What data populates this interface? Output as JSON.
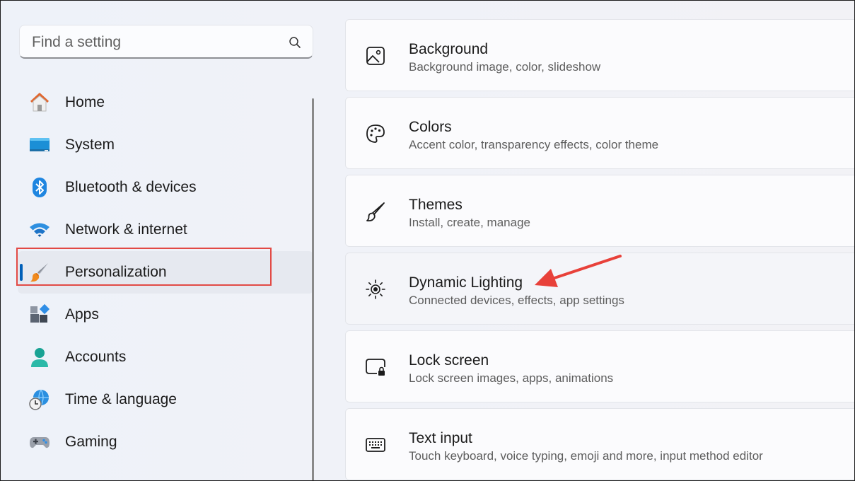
{
  "search": {
    "placeholder": "Find a setting",
    "icon": "search-icon"
  },
  "sidebar": {
    "items": [
      {
        "label": "Home",
        "icon": "home-icon"
      },
      {
        "label": "System",
        "icon": "system-icon"
      },
      {
        "label": "Bluetooth & devices",
        "icon": "bluetooth-icon"
      },
      {
        "label": "Network & internet",
        "icon": "wifi-icon"
      },
      {
        "label": "Personalization",
        "icon": "paintbrush-icon",
        "selected": true
      },
      {
        "label": "Apps",
        "icon": "apps-icon"
      },
      {
        "label": "Accounts",
        "icon": "accounts-icon"
      },
      {
        "label": "Time & language",
        "icon": "globe-clock-icon"
      },
      {
        "label": "Gaming",
        "icon": "gamepad-icon"
      }
    ]
  },
  "main": {
    "cards": [
      {
        "title": "Background",
        "subtitle": "Background image, color, slideshow",
        "icon": "image-icon"
      },
      {
        "title": "Colors",
        "subtitle": "Accent color, transparency effects, color theme",
        "icon": "palette-icon"
      },
      {
        "title": "Themes",
        "subtitle": "Install, create, manage",
        "icon": "brush-icon"
      },
      {
        "title": "Dynamic Lighting",
        "subtitle": "Connected devices, effects, app settings",
        "icon": "dynamic-lighting-icon"
      },
      {
        "title": "Lock screen",
        "subtitle": "Lock screen images, apps, animations",
        "icon": "lock-screen-icon"
      },
      {
        "title": "Text input",
        "subtitle": "Touch keyboard, voice typing, emoji and more, input method editor",
        "icon": "keyboard-icon"
      }
    ]
  },
  "colors": {
    "accent": "#005fb8",
    "annotation": "#e24a45"
  }
}
